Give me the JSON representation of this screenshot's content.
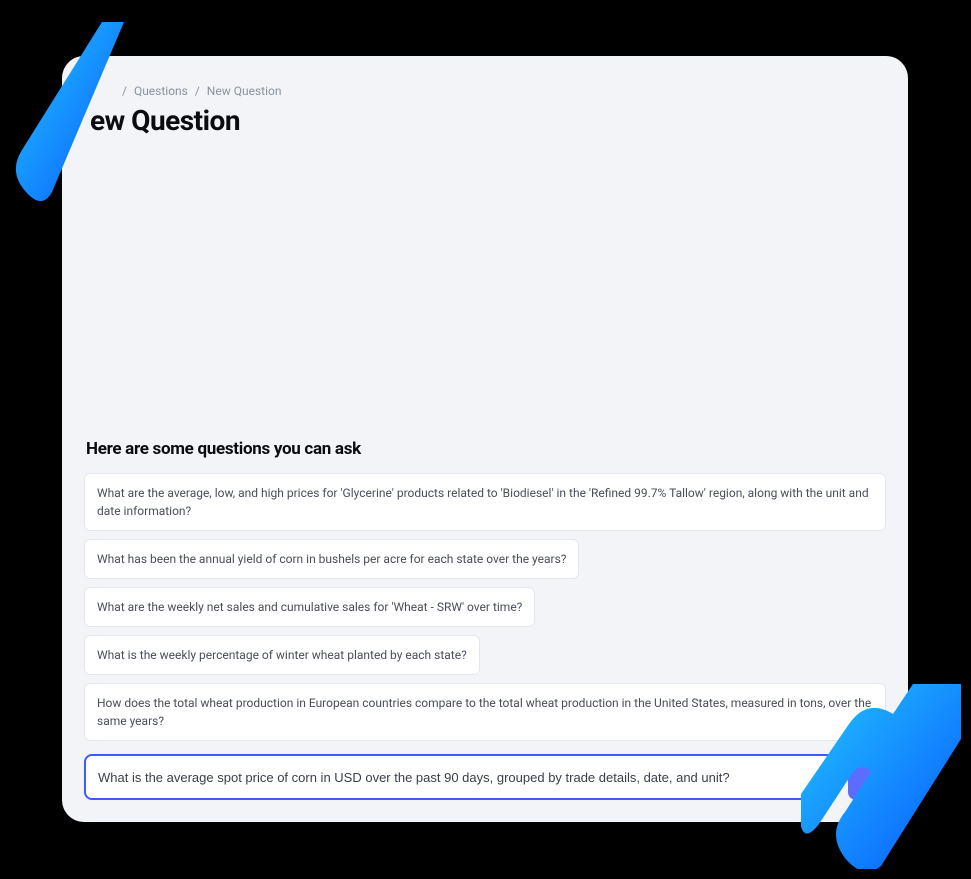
{
  "breadcrumb": {
    "questions": "Questions",
    "current": "New Question"
  },
  "title_visible": "ew Question",
  "section_title": "Here are some questions you can ask",
  "suggestions": [
    "What are the average, low, and high prices for 'Glycerine' products related to 'Biodiesel' in the 'Refined 99.7% Tallow' region, along with the unit and date information?",
    "What has been the annual yield of corn in bushels per acre for each state over the years?",
    "What are the weekly net sales and cumulative sales for 'Wheat - SRW' over time?",
    "What is the weekly percentage of winter wheat planted by each state?",
    "How does the total wheat production in European countries compare to the total wheat production in the United States, measured in tons, over the same years?"
  ],
  "input": {
    "value": "What is the average spot price of corn in USD over the past 90 days, grouped by trade details, date, and unit?"
  }
}
